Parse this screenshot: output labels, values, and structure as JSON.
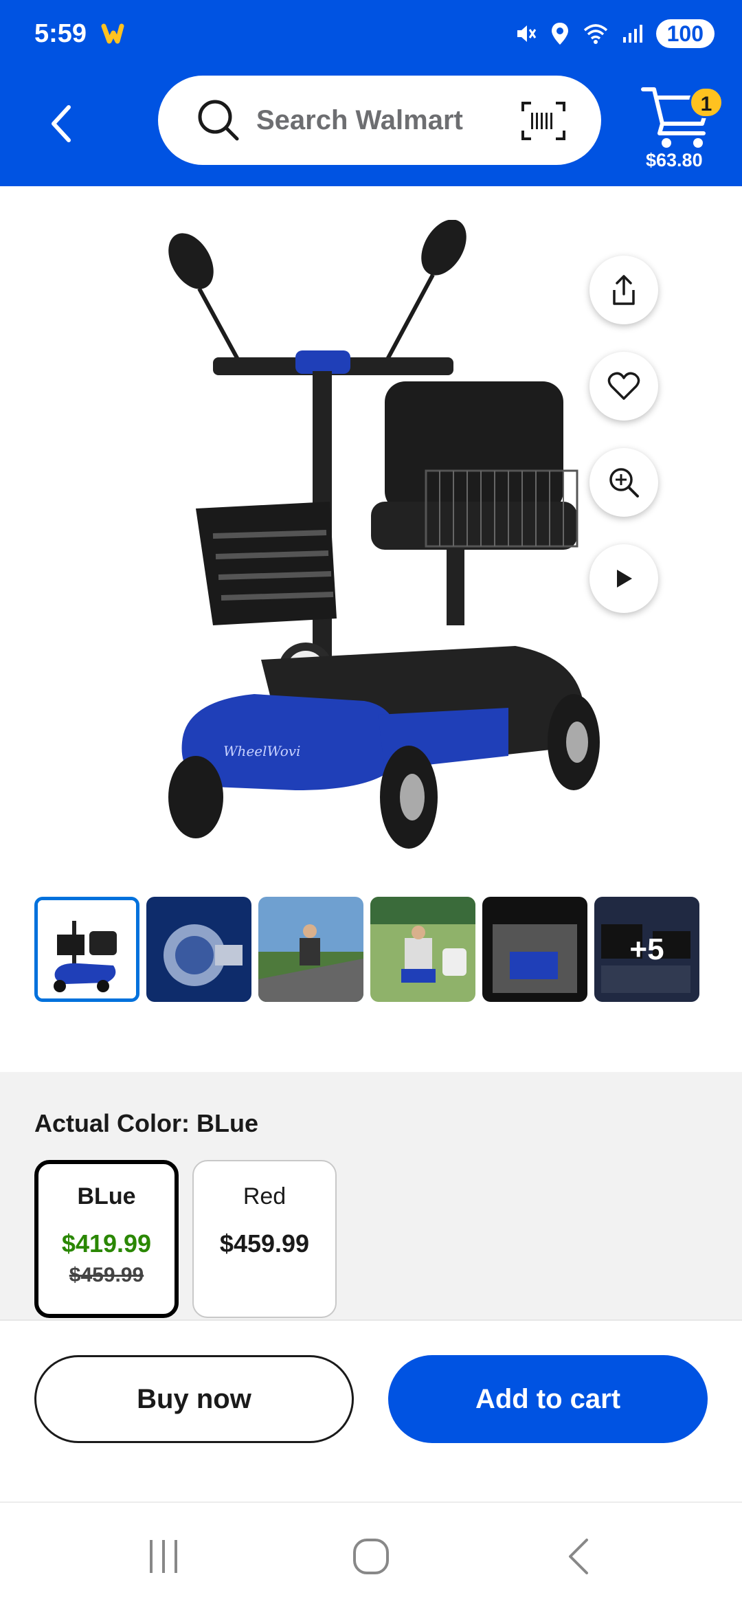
{
  "status_bar": {
    "time": "5:59",
    "battery": "100",
    "icons": [
      "walmart-spark-icon",
      "mute-icon",
      "location-icon",
      "wifi-icon",
      "signal-icon"
    ]
  },
  "header": {
    "back_icon": "chevron-left-icon",
    "search_placeholder": "Search Walmart",
    "barcode_icon": "barcode-icon",
    "cart": {
      "badge": "1",
      "total": "$63.80"
    }
  },
  "product_actions": [
    "share-icon",
    "heart-icon",
    "zoom-in-icon",
    "play-icon"
  ],
  "thumbnails": {
    "count": 6,
    "more_label": "+5"
  },
  "variant": {
    "label": "Actual Color: BLue",
    "options": [
      {
        "name": "BLue",
        "price": "$419.99",
        "original_price": "$459.99",
        "selected": true
      },
      {
        "name": "Red",
        "price": "$459.99",
        "selected": false
      }
    ]
  },
  "actions": {
    "buy_now": "Buy now",
    "add_to_cart": "Add to cart"
  },
  "navbar": [
    "recents-icon",
    "home-icon",
    "back-icon"
  ],
  "colors": {
    "brand_blue": "#0053e2",
    "spark_yellow": "#ffc220",
    "sale_green": "#2a8703"
  }
}
